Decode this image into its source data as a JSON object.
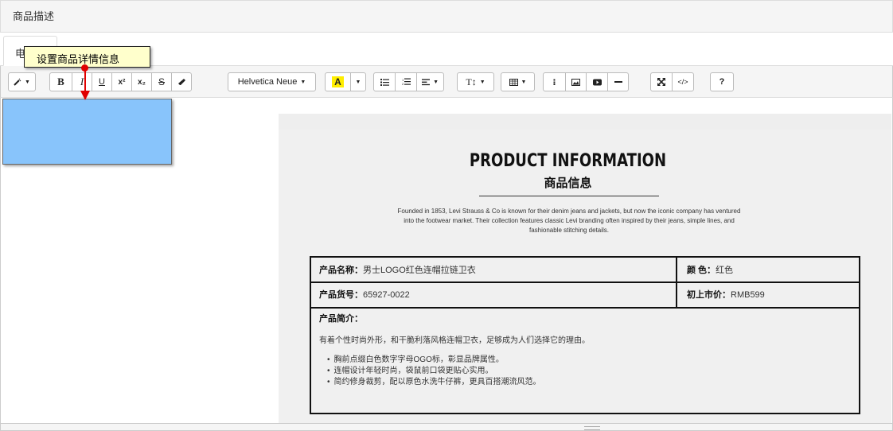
{
  "panel": {
    "title": "商品描述"
  },
  "tabs": [
    {
      "label": "电脑端"
    }
  ],
  "tooltip": {
    "text": "设置商品详情信息"
  },
  "toolbar": {
    "style_icon": "magic-wand-icon",
    "bold": "B",
    "italic": "I",
    "underline": "U",
    "superscript": "x²",
    "subscript": "x₂",
    "strikethrough": "S",
    "eraser_icon": "eraser-icon",
    "font_family": "Helvetica Neue",
    "color": "A",
    "ul_icon": "unordered-list-icon",
    "ol_icon": "ordered-list-icon",
    "align_icon": "paragraph-align-icon",
    "text_size_icon": "text-height-icon",
    "table_icon": "table-icon",
    "link_icon": "link-icon",
    "image_icon": "picture-icon",
    "video_icon": "video-icon",
    "hr_icon": "horizontal-rule-icon",
    "fullscreen_icon": "fullscreen-icon",
    "codeview": "</>",
    "help": "?"
  },
  "document": {
    "title": "PRODUCT INFORMATION",
    "subtitle": "商品信息",
    "intro": "Founded in 1853, Levi Strauss & Co is known for their denim jeans and jackets, but now the iconic company has ventured into the footwear market. Their collection features classic Levi branding often inspired by their jeans, simple lines, and fashionable stitching details.",
    "name_label": "产品名称：",
    "name_value": "男士LOGO红色连帽拉链卫衣",
    "color_label": "颜 色：",
    "color_value": "红色",
    "sku_label": "产品货号：",
    "sku_value": "65927-0022",
    "price_label": "初上市价：",
    "price_value": "RMB599",
    "summary_label": "产品简介：",
    "summary_text": "有着个性时尚外形，和干脆利落风格连帽卫衣，足够成为人们选择它的理由。",
    "bullets": [
      "胸前点缀白色数字字母OGO标，彰显品牌属性。",
      "连帽设计年轻时尚，袋鼠前口袋更贴心实用。",
      "简约修身裁剪，配以原色水洗牛仔裤，更具百搭潮流风范。"
    ]
  }
}
